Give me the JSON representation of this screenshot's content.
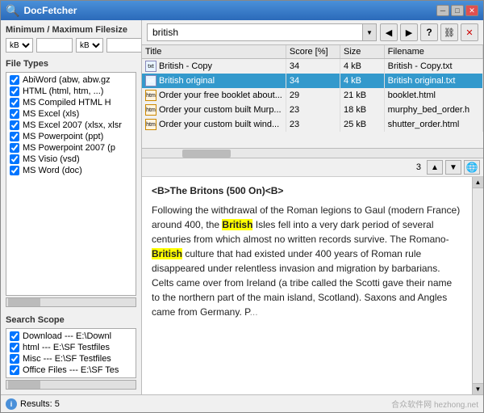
{
  "window": {
    "title": "DocFetcher",
    "controls": [
      "minimize",
      "maximize",
      "close"
    ]
  },
  "left_panel": {
    "filesize_section": {
      "label": "Minimum / Maximum Filesize",
      "min_unit": "kB",
      "max_unit": "kB",
      "min_value": "",
      "max_value": ""
    },
    "file_types_section": {
      "label": "File Types",
      "items": [
        {
          "label": "AbiWord (abw, abw.gz",
          "checked": true
        },
        {
          "label": "HTML (html, htm, ...)",
          "checked": true
        },
        {
          "label": "MS Compiled HTML H",
          "checked": true
        },
        {
          "label": "MS Excel (xls)",
          "checked": true
        },
        {
          "label": "MS Excel 2007 (xlsx, xlsr",
          "checked": true
        },
        {
          "label": "MS Powerpoint (ppt)",
          "checked": true
        },
        {
          "label": "MS Powerpoint 2007 (p",
          "checked": true
        },
        {
          "label": "MS Visio (vsd)",
          "checked": true
        },
        {
          "label": "MS Word (doc)",
          "checked": true
        }
      ]
    },
    "search_scope_section": {
      "label": "Search Scope",
      "items": [
        {
          "label": "Download --- E:\\Downl",
          "checked": true
        },
        {
          "label": "html --- E:\\SF Testfiles",
          "checked": true
        },
        {
          "label": "Misc --- E:\\SF Testfiles",
          "checked": true
        },
        {
          "label": "Office Files --- E:\\SF Tes",
          "checked": true
        }
      ]
    },
    "status": "Results: 5"
  },
  "search_bar": {
    "query": "british",
    "placeholder": "british"
  },
  "results_table": {
    "columns": [
      "Title",
      "Score [%]",
      "Size",
      "Filename"
    ],
    "rows": [
      {
        "icon": "txt",
        "title": "British - Copy",
        "score": "34",
        "size": "4 kB",
        "filename": "British - Copy.txt",
        "selected": false
      },
      {
        "icon": "txt",
        "title": "British original",
        "score": "34",
        "size": "4 kB",
        "filename": "British original.txt",
        "selected": true
      },
      {
        "icon": "html",
        "title": "Order your free booklet about...",
        "score": "29",
        "size": "21 kB",
        "filename": "booklet.html",
        "selected": false
      },
      {
        "icon": "html",
        "title": "Order your custom built Murp...",
        "score": "23",
        "size": "18 kB",
        "filename": "murphy_bed_order.h",
        "selected": false
      },
      {
        "icon": "html",
        "title": "Order your custom built wind...",
        "score": "23",
        "size": "25 kB",
        "filename": "shutter_order.html",
        "selected": false
      }
    ]
  },
  "preview": {
    "page_number": "3",
    "nav_prev": "▲",
    "nav_next": "▼",
    "content_html": true,
    "paragraphs": [
      "<B>The Britons (500 On)<B>",
      "Following the withdrawal of the Roman legions to Gaul (modern France) around 400, the <mark>British</mark> Isles fell into a very dark period of several centuries from which almost no written records survive. The Romano-<mark>British</mark> culture that had existed under 400 years of Roman rule disappeared under relentless invasion and migration by barbarians. Celts came over from Ireland (a tribe called the Scotti gave their name to the northern part of the main island, Scotland). Saxons and Angles came from Germany. P..."
    ]
  },
  "icons": {
    "minimize": "─",
    "maximize": "□",
    "close": "✕",
    "dropdown": "▼",
    "nav_back": "◀",
    "nav_forward": "▶",
    "nav_up": "▲",
    "nav_down": "▼",
    "refresh": "↻",
    "link": "⛓",
    "window_close": "✕",
    "info": "i"
  }
}
